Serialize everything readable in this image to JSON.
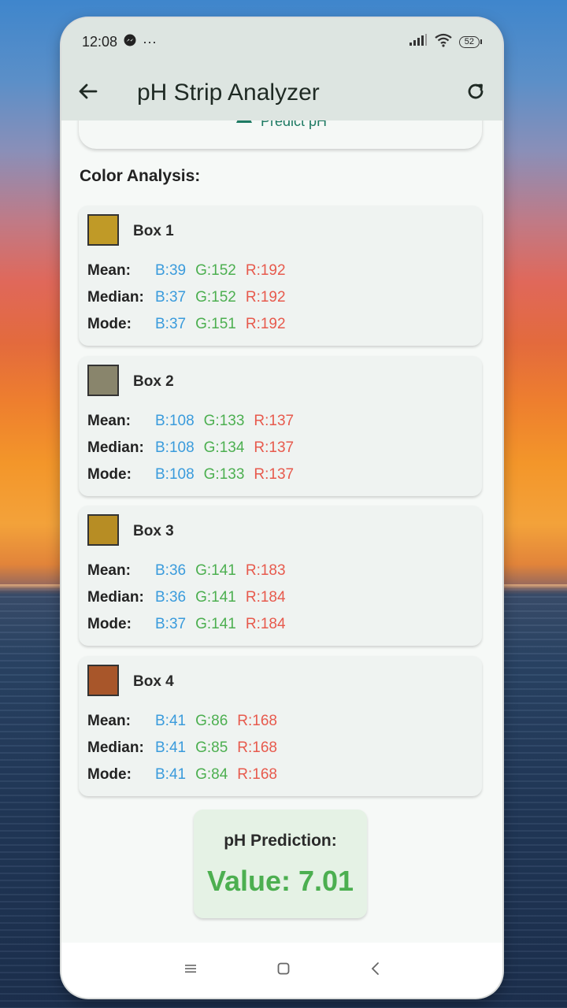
{
  "status_bar": {
    "time": "12:08",
    "more": "···",
    "battery": "52"
  },
  "app_bar": {
    "title": "pH Strip Analyzer"
  },
  "predict_button": {
    "label": "Predict pH"
  },
  "analysis": {
    "title": "Color Analysis:",
    "boxes": [
      {
        "name": "Box 1",
        "swatch_color": "#c09a27",
        "rows": [
          {
            "label": "Mean:",
            "b": "B:39",
            "g": "G:152",
            "r": "R:192"
          },
          {
            "label": "Median:",
            "b": "B:37",
            "g": "G:152",
            "r": "R:192"
          },
          {
            "label": "Mode:",
            "b": "B:37",
            "g": "G:151",
            "r": "R:192"
          }
        ]
      },
      {
        "name": "Box 2",
        "swatch_color": "#89856c",
        "rows": [
          {
            "label": "Mean:",
            "b": "B:108",
            "g": "G:133",
            "r": "R:137"
          },
          {
            "label": "Median:",
            "b": "B:108",
            "g": "G:134",
            "r": "R:137"
          },
          {
            "label": "Mode:",
            "b": "B:108",
            "g": "G:133",
            "r": "R:137"
          }
        ]
      },
      {
        "name": "Box 3",
        "swatch_color": "#b78d24",
        "rows": [
          {
            "label": "Mean:",
            "b": "B:36",
            "g": "G:141",
            "r": "R:183"
          },
          {
            "label": "Median:",
            "b": "B:36",
            "g": "G:141",
            "r": "R:184"
          },
          {
            "label": "Mode:",
            "b": "B:37",
            "g": "G:141",
            "r": "R:184"
          }
        ]
      },
      {
        "name": "Box 4",
        "swatch_color": "#a8562a",
        "rows": [
          {
            "label": "Mean:",
            "b": "B:41",
            "g": "G:86",
            "r": "R:168"
          },
          {
            "label": "Median:",
            "b": "B:41",
            "g": "G:85",
            "r": "R:168"
          },
          {
            "label": "Mode:",
            "b": "B:41",
            "g": "G:84",
            "r": "R:168"
          }
        ]
      }
    ]
  },
  "prediction": {
    "title": "pH Prediction:",
    "value": "Value: 7.01"
  },
  "colors": {
    "blue": "#3a9bdc",
    "green": "#4caf50",
    "red": "#e75a4d",
    "accent": "#1e7a63"
  }
}
